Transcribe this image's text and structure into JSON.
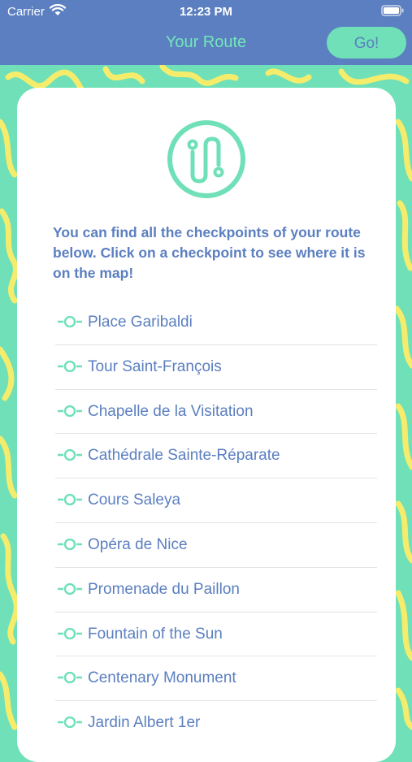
{
  "status_bar": {
    "carrier": "Carrier",
    "time": "12:23 PM"
  },
  "header": {
    "title": "Your Route",
    "go_label": "Go!"
  },
  "intro_text": "You can find all the checkpoints of your route below. Click on a checkpoint to see where it is on the map!",
  "checkpoints": [
    {
      "label": "Place Garibaldi"
    },
    {
      "label": "Tour Saint-François"
    },
    {
      "label": "Chapelle de la Visitation"
    },
    {
      "label": "Cathédrale Sainte-Réparate"
    },
    {
      "label": "Cours Saleya"
    },
    {
      "label": "Opéra de Nice"
    },
    {
      "label": "Promenade du Paillon"
    },
    {
      "label": "Fountain of the Sun"
    },
    {
      "label": "Centenary Monument"
    },
    {
      "label": "Jardin Albert 1er"
    }
  ],
  "colors": {
    "primary_blue": "#5b7fc0",
    "mint": "#6fe0b8",
    "squiggle_yellow": "#f6ec6c"
  }
}
